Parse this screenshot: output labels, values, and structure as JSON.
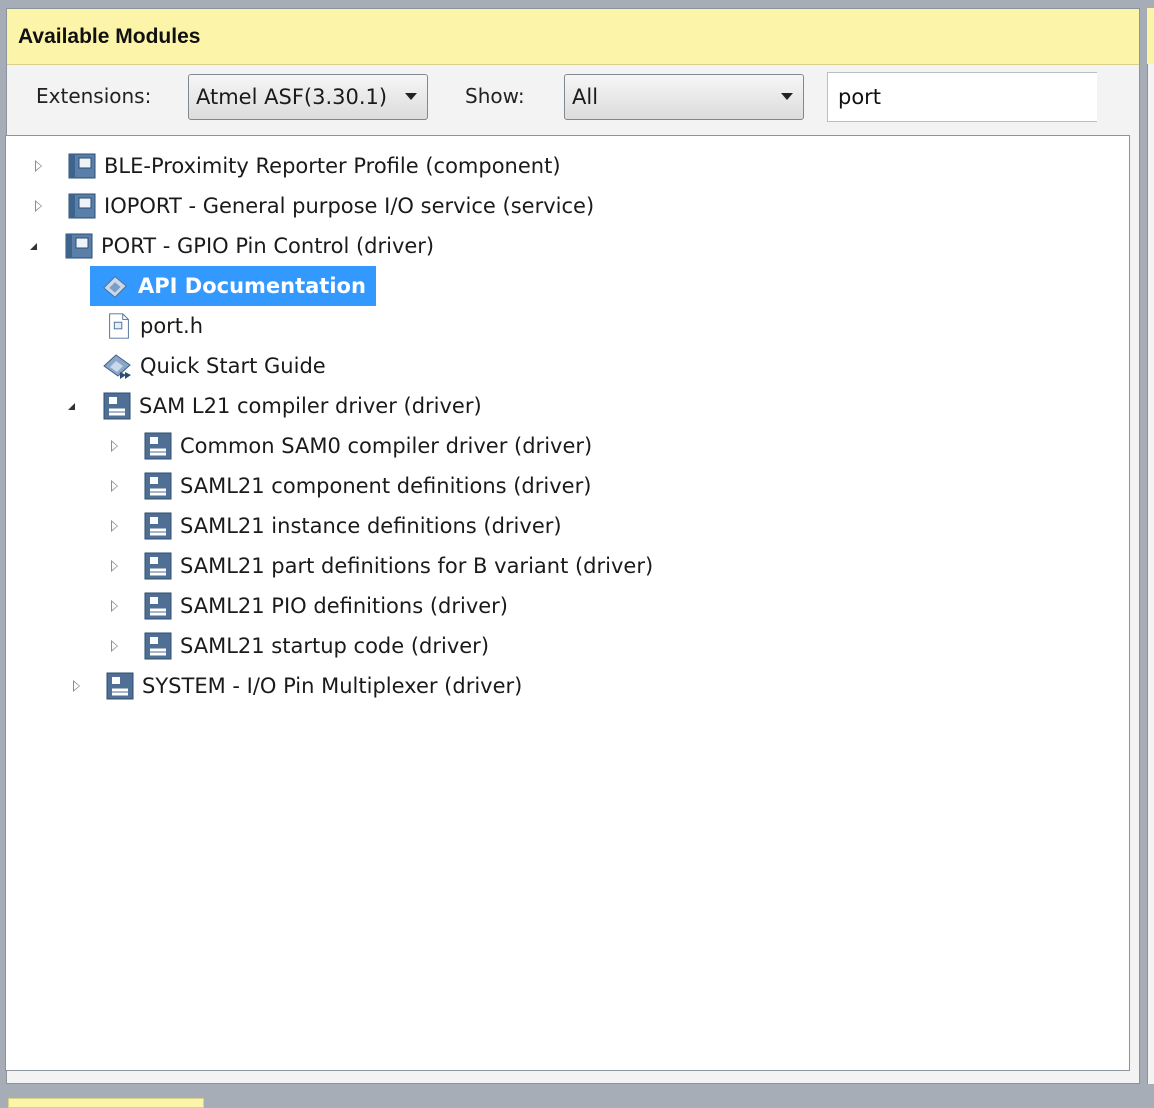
{
  "panel": {
    "title": "Available Modules"
  },
  "toolbar": {
    "extensions_label": "Extensions:",
    "extensions_value": "Atmel ASF(3.30.1)",
    "show_label": "Show:",
    "show_value": "All",
    "search_value": "port"
  },
  "tree": {
    "items": [
      {
        "label": "BLE-Proximity Reporter Profile (component)"
      },
      {
        "label": "IOPORT - General purpose I/O service (service)"
      },
      {
        "label": "PORT - GPIO Pin Control (driver)"
      },
      {
        "label": "API Documentation"
      },
      {
        "label": "port.h"
      },
      {
        "label": "Quick Start Guide"
      },
      {
        "label": "SAM L21 compiler driver (driver)"
      },
      {
        "label": "Common SAM0 compiler driver (driver)"
      },
      {
        "label": "SAML21 component definitions (driver)"
      },
      {
        "label": "SAML21 instance definitions (driver)"
      },
      {
        "label": "SAML21 part definitions for B variant (driver)"
      },
      {
        "label": "SAML21 PIO definitions (driver)"
      },
      {
        "label": "SAML21 startup code (driver)"
      },
      {
        "label": "SYSTEM - I/O Pin Multiplexer (driver)"
      }
    ]
  },
  "colors": {
    "header_bg": "#fcf5a9",
    "selection": "#3399ff"
  }
}
